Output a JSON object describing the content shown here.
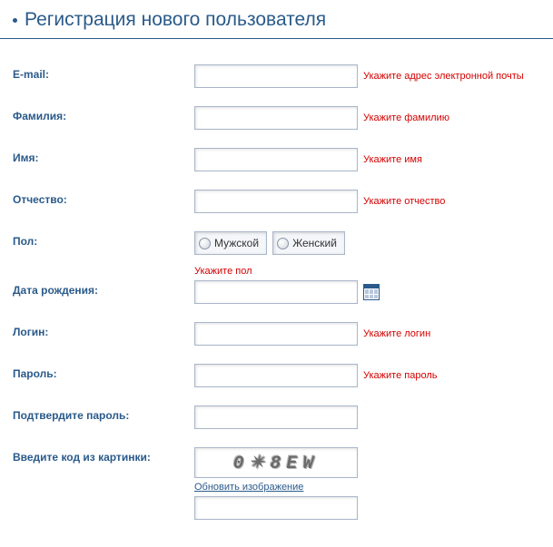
{
  "header": {
    "title": "Регистрация нового пользователя"
  },
  "fields": {
    "email": {
      "label": "E-mail:",
      "error": "Укажите адрес электронной почты"
    },
    "lastname": {
      "label": "Фамилия:",
      "error": "Укажите фамилию"
    },
    "firstname": {
      "label": "Имя:",
      "error": "Укажите имя"
    },
    "middlename": {
      "label": "Отчество:",
      "error": "Укажите отчество"
    },
    "gender": {
      "label": "Пол:",
      "options": {
        "male": "Мужской",
        "female": "Женский"
      },
      "error": "Укажите пол"
    },
    "dob": {
      "label": "Дата рождения:"
    },
    "login": {
      "label": "Логин:",
      "error": "Укажите логин"
    },
    "password": {
      "label": "Пароль:",
      "error": "Укажите пароль"
    },
    "confirm": {
      "label": "Подтвердите пароль:"
    },
    "captcha": {
      "label": "Введите код из картинки:",
      "image_text": "0✴8EW",
      "refresh": "Обновить изображение"
    }
  }
}
